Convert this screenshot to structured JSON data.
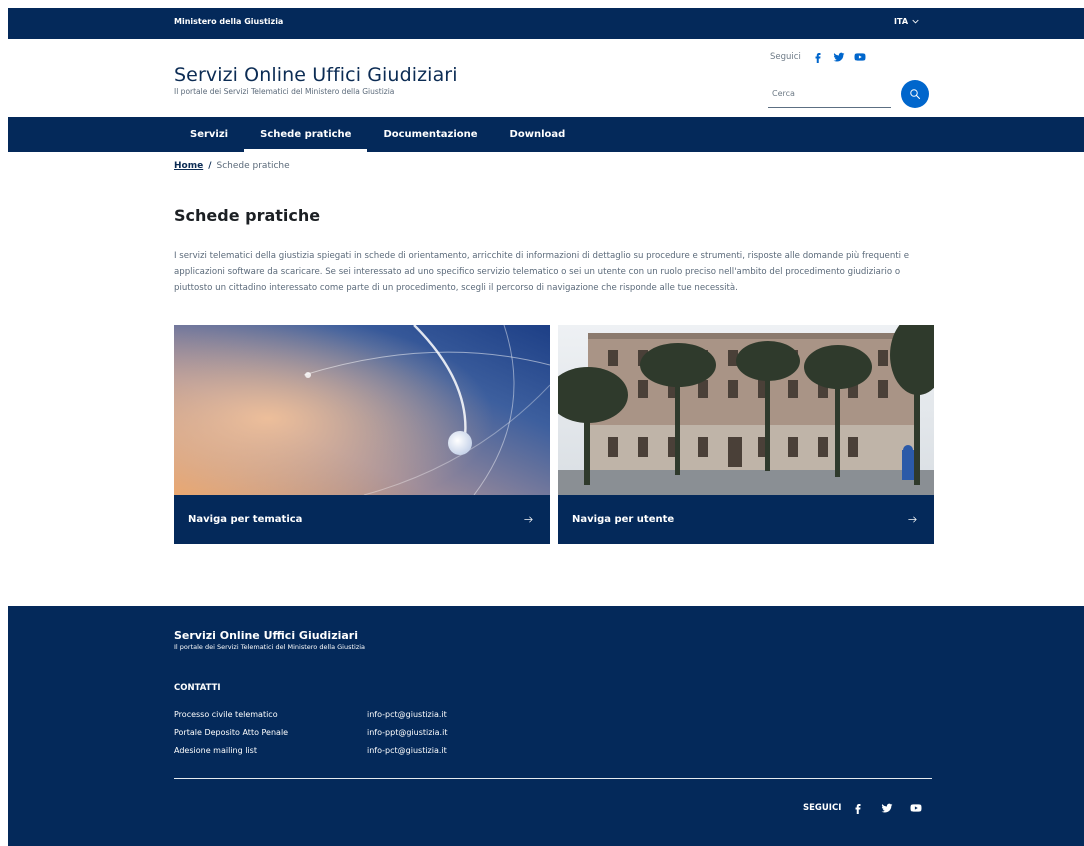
{
  "slimbar": {
    "owner": "Ministero della Giustizia",
    "language": "ITA"
  },
  "header": {
    "title": "Servizi Online Uffici Giudiziari",
    "tagline": "Il portale dei Servizi Telematici del Ministero della Giustizia",
    "follow_label": "Seguici",
    "search_placeholder": "Cerca"
  },
  "nav": {
    "items": [
      {
        "label": "Servizi"
      },
      {
        "label": "Schede pratiche"
      },
      {
        "label": "Documentazione"
      },
      {
        "label": "Download"
      }
    ],
    "active": "Schede pratiche"
  },
  "breadcrumb": {
    "home": "Home",
    "separator": "/",
    "current": "Schede pratiche"
  },
  "main": {
    "title": "Schede pratiche",
    "intro": "I servizi telematici della giustizia spiegati in schede di orientamento, arricchite di informazioni di dettaglio su procedure e strumenti, risposte alle domande più frequenti e applicazioni software da scaricare. Se sei interessato ad uno specifico servizio telematico o sei un utente con un ruolo preciso nell'ambito del procedimento giudiziario o piuttosto un cittadino interessato come parte di un procedimento, scegli il percorso di navigazione che risponde alle tue necessità.",
    "cards": [
      {
        "label": "Naviga per tematica"
      },
      {
        "label": "Naviga per utente"
      }
    ]
  },
  "footer": {
    "title": "Servizi Online Uffici Giudiziari",
    "tagline": "Il portale dei Servizi Telematici del Ministero della Giustizia",
    "contacts_heading": "CONTATTI",
    "contacts": [
      {
        "name": "Processo civile telematico",
        "email": "info-pct@giustizia.it"
      },
      {
        "name": "Portale Deposito Atto Penale",
        "email": "info-ppt@giustizia.it"
      },
      {
        "name": "Adesione mailing list",
        "email": "info-pct@giustizia.it"
      }
    ],
    "follow_label": "SEGUICI"
  },
  "colors": {
    "primary_dark": "#04295a",
    "accent": "#0066cc"
  },
  "icons": [
    "chevron-down-icon",
    "facebook-icon",
    "twitter-icon",
    "youtube-icon",
    "search-icon",
    "arrow-right-icon"
  ]
}
